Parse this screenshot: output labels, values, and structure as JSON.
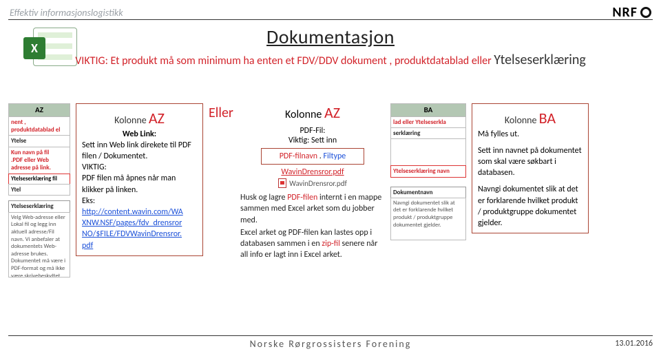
{
  "header": {
    "tagline": "Effektiv informasjonslogistikk",
    "title": "Dokumentasjon",
    "subtitle_red": "VIKTIG: Et produkt må som minimum ha enten et FDV/DDV dokument , produktdatablad eller ",
    "subtitle_ye": "Ytelseserklæring",
    "logo_text": "NRF"
  },
  "snip_az": {
    "col": "AZ",
    "row1": "nent , produktdatablad el",
    "row2": "Ytelse",
    "row3a": "Kun navn på fil",
    "row3b": ".PDF eller Web",
    "row3c": "adresse på link.",
    "row4": "Ytelseserklæring fil",
    "row5": "Ytel",
    "box_title": "Ytelseserklæring",
    "box_text": "Velg Web-adresse eller Lokal fil og legg inn aktuell adresse/Fil navn. Vi anbefaler at dokumentets Web-adresse brukes. Dokumentet må være i PDF-format og må ikke være skrivebeskyttet."
  },
  "box_az": {
    "line1_pre": "Kolonne ",
    "line1_az": "AZ",
    "line2": "Web Link:",
    "line3": "Sett inn Web link direkete til PDF filen / Dokumentet.",
    "line4": "VIKTIG:",
    "line5": "PDF filen må åpnes når man klikker på linken.",
    "line6": "Eks:",
    "link1": "http://content.wavin.com/WA",
    "link2": "XNW.NSF/pages/fdv_drensror",
    "link3": "NO/$FILE/FDVWavinDrensror.",
    "link4": "pdf"
  },
  "eller": "Eller",
  "col_az2": {
    "line1_pre": "Kolonne ",
    "line1_az": "AZ",
    "line2": "PDF-Fil:",
    "line3": "Viktig: Sett inn",
    "filnavn": "PDF-filnavn",
    "dot": " . ",
    "filtype": "Filtype",
    "wavin": "WavinDrensror.pdf",
    "wavin2": "WavinDrensror.pdf",
    "desc1_a": "Husk og lagre ",
    "desc1_b": "PDF-filen",
    "desc1_c": " internt i en mappe sammen med Excel arket som du jobber med.",
    "desc2_a": "Excel arket og PDF-filen kan lastes opp i databasen sammen i en ",
    "desc2_b": "zip-fil",
    "desc2_c": " senere når all info er lagt inn i Excel arket."
  },
  "snip_ba": {
    "col": "BA",
    "row1": "lad eller Ytelseserkla",
    "row2": "serklæring",
    "row3": "",
    "row4": "Ytelseserklæring navn",
    "box_title": "Dokumentnavn",
    "box_text": "Navngi dokumentet slik at det er forklarende hvilket produkt / produktgruppe dokumentet gjelder."
  },
  "box_ba": {
    "line1_pre": "Kolonne ",
    "line1_ba": "BA",
    "line2": "Må fylles ut.",
    "line3": "Sett inn navnet på dokumentet som skal være søkbart i databasen.",
    "line4": "Navngi dokumentet slik at det er forklarende hvilket produkt / produktgruppe dokumentet gjelder."
  },
  "footer": {
    "center": "Norske Rørgrossisters Forening",
    "date": "13.01.2016"
  }
}
